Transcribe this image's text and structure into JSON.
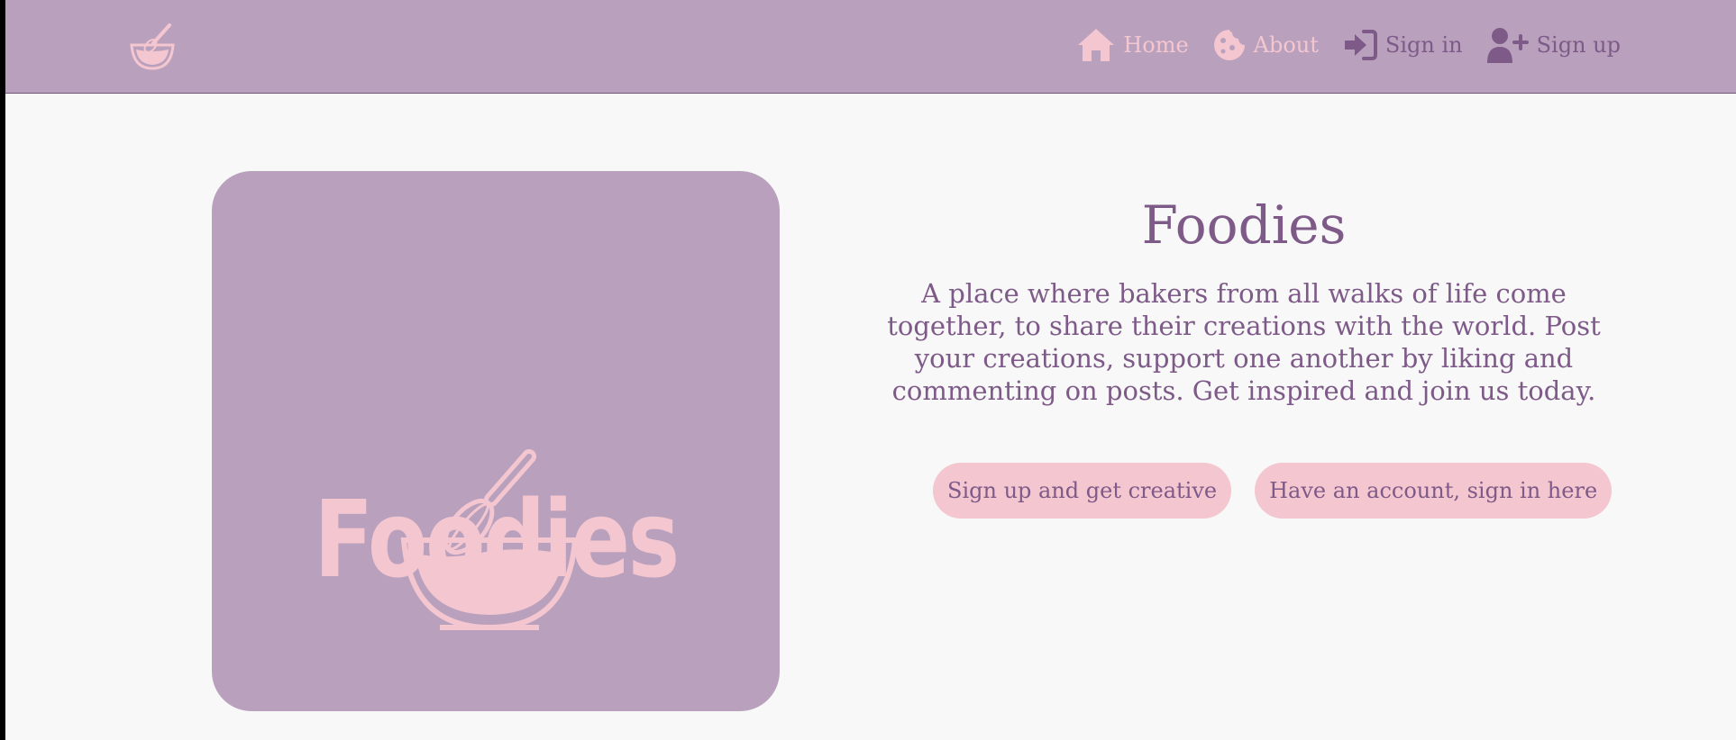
{
  "nav": {
    "logo_icon": "whisk-bowl-icon",
    "items": [
      {
        "label": "Home",
        "icon": "home-icon",
        "color": "#f4c6d0"
      },
      {
        "label": "About",
        "icon": "cookie-icon",
        "color": "#f4c6d0"
      },
      {
        "label": "Sign in",
        "icon": "sign-in-icon",
        "color": "#7e5a88"
      },
      {
        "label": "Sign up",
        "icon": "user-plus-icon",
        "color": "#7e5a88"
      }
    ]
  },
  "hero": {
    "logo_text": "Foodies",
    "title": "Foodies",
    "description": "A place where bakers from all walks of life come together, to share their creations with the world. Post your creations, support one another by liking and commenting on posts. Get inspired and join us today.",
    "buttons": {
      "signup": "Sign up and get creative",
      "signin": "Have an account, sign in here"
    }
  },
  "colors": {
    "nav_bg": "#b9a1bd",
    "accent_pink": "#f4c6d0",
    "accent_purple": "#7e5a88",
    "page_bg": "#f8f8f8"
  }
}
